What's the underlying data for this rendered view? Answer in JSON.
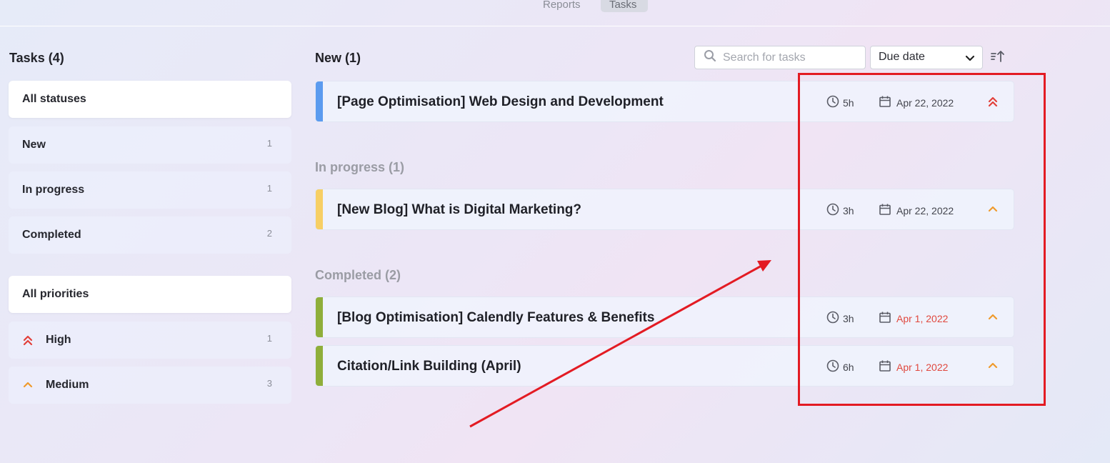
{
  "top_tabs": [
    {
      "label": "Reports"
    },
    {
      "label": "Tasks",
      "active": true
    }
  ],
  "sidebar": {
    "title": "Tasks (4)",
    "status_filters": [
      {
        "label": "All statuses",
        "count": "",
        "selected": true
      },
      {
        "label": "New",
        "count": "1"
      },
      {
        "label": "In progress",
        "count": "1"
      },
      {
        "label": "Completed",
        "count": "2"
      }
    ],
    "priority_filters": [
      {
        "label": "All priorities",
        "count": "",
        "selected": true
      },
      {
        "label": "High",
        "count": "1",
        "icon": "double-chevron-up-icon"
      },
      {
        "label": "Medium",
        "count": "3",
        "icon": "chevron-up-icon"
      }
    ]
  },
  "toolbar": {
    "search_placeholder": "Search for tasks",
    "sort_value": "Due date"
  },
  "sections": [
    {
      "title": "New (1)",
      "tasks": [
        {
          "title": "[Page Optimisation] Web Design and Development",
          "duration": "5h",
          "due": "Apr 22, 2022",
          "overdue": false,
          "priority": "high",
          "stripe_color": "#5b9bef"
        }
      ]
    },
    {
      "title": "In progress (1)",
      "tasks": [
        {
          "title": "[New Blog] What is Digital Marketing?",
          "duration": "3h",
          "due": "Apr 22, 2022",
          "overdue": false,
          "priority": "medium",
          "stripe_color": "#f7cf64"
        }
      ]
    },
    {
      "title": "Completed (2)",
      "tasks": [
        {
          "title": "[Blog Optimisation] Calendly Features & Benefits",
          "duration": "3h",
          "due": "Apr 1, 2022",
          "overdue": true,
          "priority": "medium",
          "stripe_color": "#8fae3a"
        },
        {
          "title": "Citation/Link Building (April)",
          "duration": "6h",
          "due": "Apr 1, 2022",
          "overdue": true,
          "priority": "medium",
          "stripe_color": "#8fae3a"
        }
      ]
    }
  ],
  "colors": {
    "high_priority": "#e2403a",
    "medium_priority": "#ef9a2c",
    "overdue_text": "#e0483e",
    "annotation": "#e31b23"
  }
}
